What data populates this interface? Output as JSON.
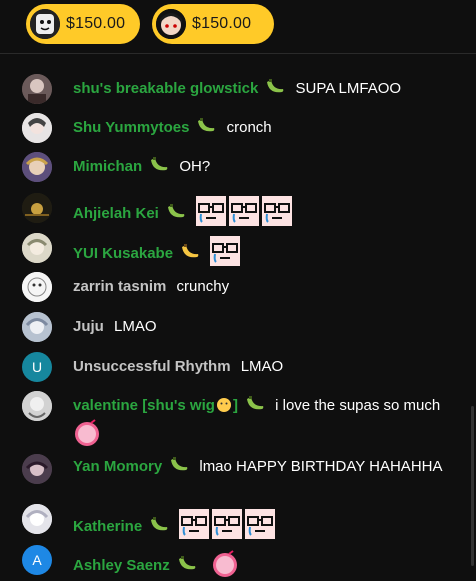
{
  "super_chats": [
    {
      "amount": "$150.00"
    },
    {
      "amount": "$150.00"
    }
  ],
  "messages": [
    {
      "author": "shu's breakable glowstick",
      "text": "SUPA LMFAOO",
      "author_color": "green"
    },
    {
      "author": "Shu Yummytoes",
      "text": "cronch",
      "author_color": "green"
    },
    {
      "author": "Mimichan",
      "text": "OH?",
      "author_color": "green"
    },
    {
      "author": "Ahjielah Kei",
      "text": "",
      "author_color": "green"
    },
    {
      "author": "YUI Kusakabe",
      "text": "",
      "author_color": "green"
    },
    {
      "author": "zarrin tasnim",
      "text": "crunchy",
      "author_color": "gray"
    },
    {
      "author": "Juju",
      "text": "LMAO",
      "author_color": "gray"
    },
    {
      "author": "Unsuccessful Rhythm",
      "text": "LMAO",
      "author_color": "gray",
      "avatar_letter": "U"
    },
    {
      "author": "valentine [shu's wig",
      "author_suffix": "]",
      "text": "i love the supas so much",
      "author_color": "green"
    },
    {
      "author": "Yan Momory",
      "text": "lmao HAPPY BIRTHDAY HAHAHHA",
      "author_color": "green"
    },
    {
      "author": "Katherine",
      "text": "",
      "author_color": "green"
    },
    {
      "author": "Ashley Saenz",
      "text": "",
      "author_color": "green",
      "avatar_letter": "A"
    }
  ],
  "colors": {
    "member_green": "#2ba640",
    "chip_yellow": "#ffca28",
    "badge_banana": "#8bc34a"
  }
}
